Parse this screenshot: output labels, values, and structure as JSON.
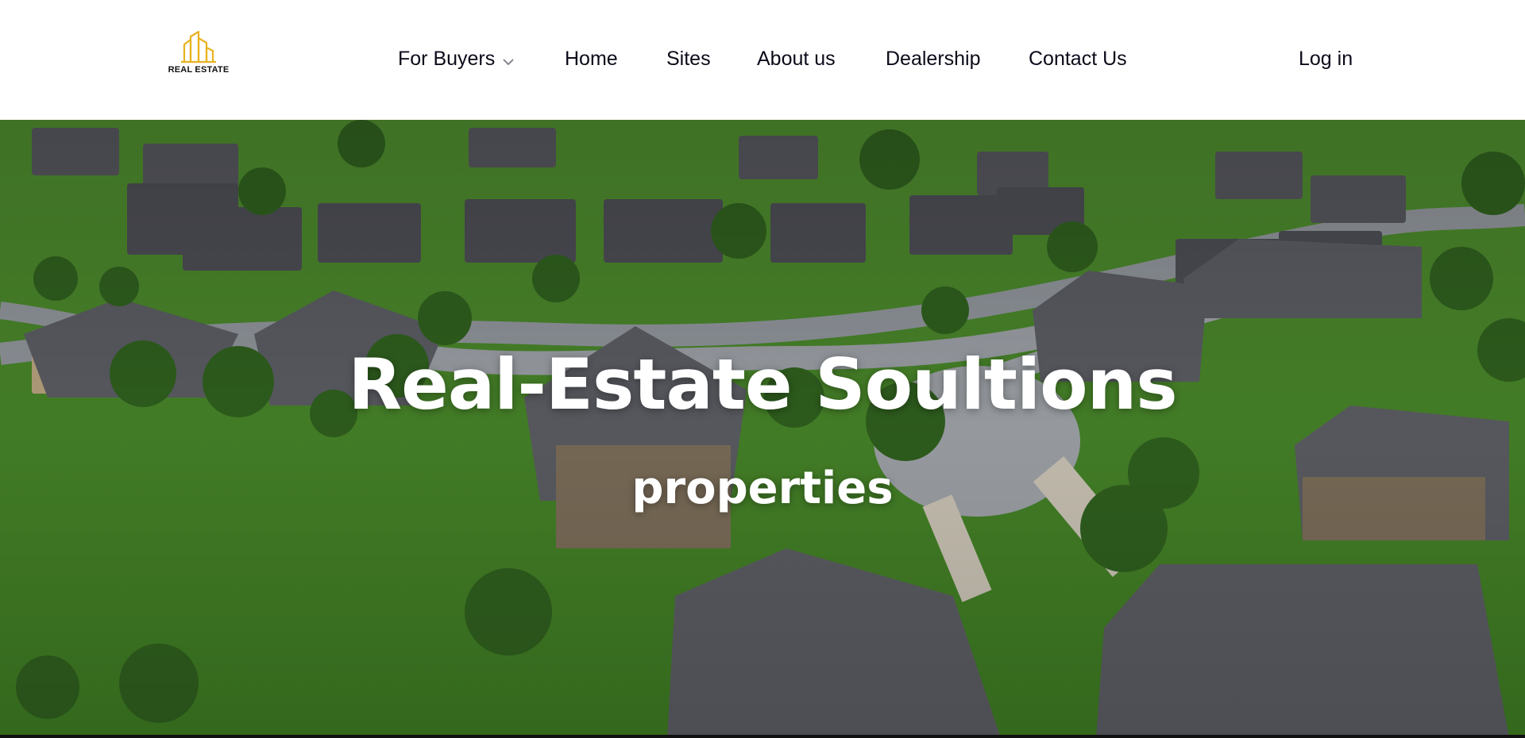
{
  "brand": {
    "logo_text": "REAL ESTATE",
    "accent_color": "#e8b21e"
  },
  "nav": {
    "items": [
      {
        "label": "For Buyers",
        "has_dropdown": true
      },
      {
        "label": "Home"
      },
      {
        "label": "Sites"
      },
      {
        "label": "About us"
      },
      {
        "label": "Dealership"
      },
      {
        "label": "Contact Us"
      }
    ],
    "login_label": "Log in"
  },
  "hero": {
    "title": "Real-Estate Soultions",
    "subtitle": "properties"
  }
}
